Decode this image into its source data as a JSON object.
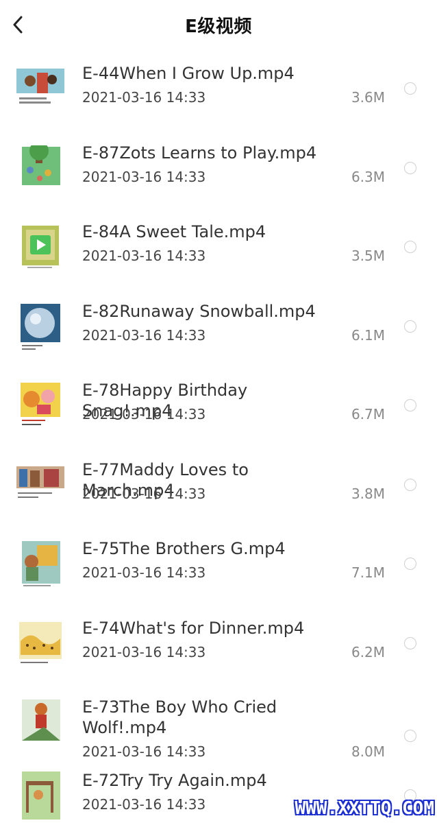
{
  "header": {
    "title": "E级视频"
  },
  "items": [
    {
      "name": "E-44When I Grow Up.mp4",
      "date": "2021-03-16 14:33",
      "size": "3.6M"
    },
    {
      "name": "E-87Zots Learns to Play.mp4",
      "date": "2021-03-16 14:33",
      "size": "6.3M"
    },
    {
      "name": "E-84A Sweet Tale.mp4",
      "date": "2021-03-16 14:33",
      "size": "3.5M"
    },
    {
      "name": "E-82Runaway Snowball.mp4",
      "date": "2021-03-16 14:33",
      "size": "6.1M"
    },
    {
      "name": "E-78Happy Birthday Snag!.mp4",
      "date": "2021-03-16 14:33",
      "size": "6.7M"
    },
    {
      "name": "E-77Maddy Loves to March.mp4",
      "date": "2021-03-16 14:33",
      "size": "3.8M"
    },
    {
      "name": "E-75The Brothers G.mp4",
      "date": "2021-03-16 14:33",
      "size": "7.1M"
    },
    {
      "name": "E-74What's for Dinner.mp4",
      "date": "2021-03-16 14:33",
      "size": "6.2M"
    },
    {
      "name": "E-73The Boy Who Cried Wolf!.mp4",
      "date": "2021-03-16 14:33",
      "size": "8.0M"
    },
    {
      "name": "E-72Try Try Again.mp4",
      "date": "2021-03-16 14:33",
      "size": ""
    }
  ],
  "icons": {
    "back": "chevron-left-icon",
    "play": "play-icon",
    "select": "radio-circle-icon"
  },
  "colors": {
    "play_overlay": "#4cc25a",
    "watermark": "#1c2fd1"
  },
  "watermark": "WWW.XXTTQ.COM"
}
